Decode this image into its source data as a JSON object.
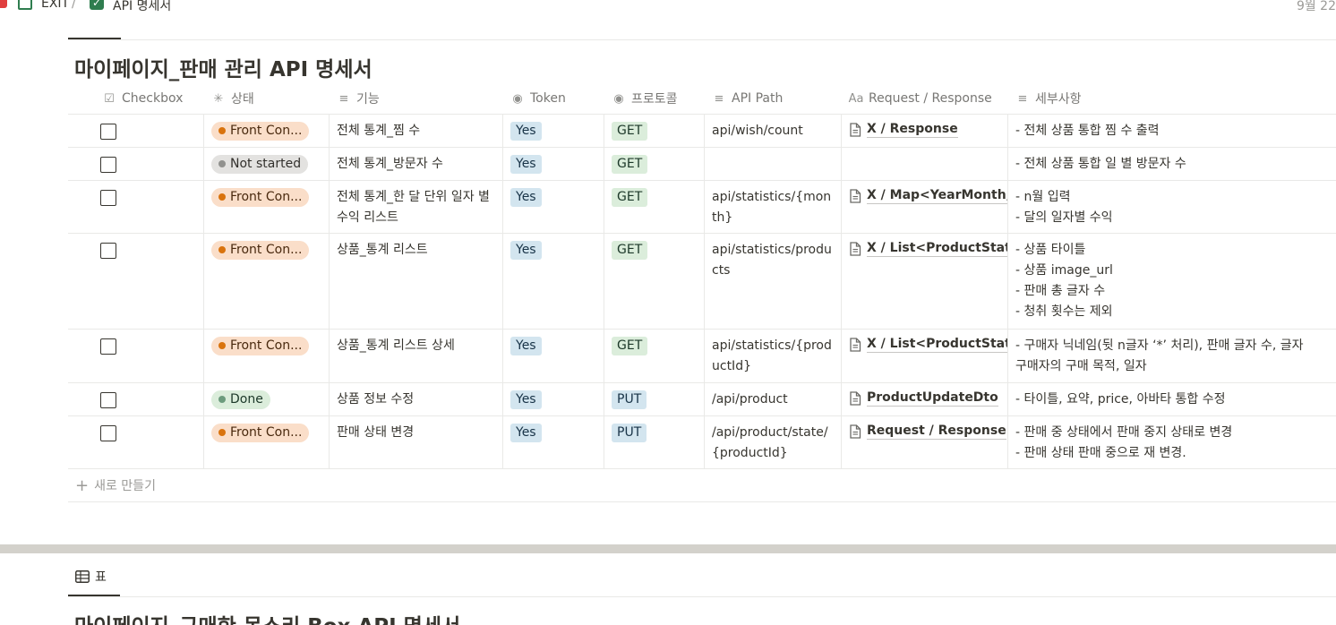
{
  "breadcrumb": {
    "items": [
      "EXIT",
      "API 명세서"
    ],
    "separator": "/",
    "date": "9월 22"
  },
  "database": {
    "view_tab": "",
    "title": "마이페이지_판매 관리 API 명세서",
    "columns": [
      {
        "label": "Checkbox",
        "icon": "checkbox-icon"
      },
      {
        "label": "상태",
        "icon": "status-spinner-icon"
      },
      {
        "label": "기능",
        "icon": "text-lines-icon"
      },
      {
        "label": "Token",
        "icon": "select-icon"
      },
      {
        "label": "프로토콜",
        "icon": "select-icon"
      },
      {
        "label": "API Path",
        "icon": "text-lines-icon"
      },
      {
        "label": "Request / Response",
        "icon": "title-aa-icon"
      },
      {
        "label": "세부사항",
        "icon": "text-lines-icon"
      }
    ],
    "rows": [
      {
        "checked": false,
        "status": "Front Con...",
        "status_kind": "front",
        "feature": "전체 통계_찜 수",
        "token": "Yes",
        "protocol": "GET",
        "api_path": "api/wish/count",
        "request_response": "X / Response",
        "details": [
          "- 전체 상품 통합 찜 수 출력"
        ]
      },
      {
        "checked": false,
        "status": "Not started",
        "status_kind": "not",
        "feature": "전체 통계_방문자 수",
        "token": "Yes",
        "protocol": "GET",
        "api_path": "",
        "request_response": "",
        "details": [
          "- 전체 상품 통합 일 별 방문자 수"
        ]
      },
      {
        "checked": false,
        "status": "Front Con...",
        "status_kind": "front",
        "feature": "전체 통계_한 달 단위 일자 별 수익 리스트",
        "token": "Yes",
        "protocol": "GET",
        "api_path": "api/statistics/{month}",
        "request_response": "X / Map<YearMonth,",
        "details": [
          "- n월 입력",
          "- 달의 일자별 수익"
        ]
      },
      {
        "checked": false,
        "status": "Front Con...",
        "status_kind": "front",
        "feature": "상품_통계 리스트",
        "token": "Yes",
        "protocol": "GET",
        "api_path": "api/statistics/products",
        "request_response": "X / List<ProductStatis",
        "details": [
          "- 상품 타이틀",
          "- 상품 image_url",
          "- 판매 총 글자 수",
          "- 청취 횟수는 제외"
        ]
      },
      {
        "checked": false,
        "status": "Front Con...",
        "status_kind": "front",
        "feature": "상품_통계 리스트 상세",
        "token": "Yes",
        "protocol": "GET",
        "api_path": "api/statistics/{productId}",
        "request_response": "X / List<ProductStatis",
        "details": [
          "- 구매자 닉네임(뒷 n글자 ‘*’ 처리), 판매 글자 수, 글자",
          "구매자의 구매 목적, 일자"
        ]
      },
      {
        "checked": false,
        "status": "Done",
        "status_kind": "done",
        "feature": "상품 정보 수정",
        "token": "Yes",
        "protocol": "PUT",
        "api_path": "/api/product",
        "request_response": "ProductUpdateDto",
        "details": [
          "- 타이틀, 요약, price, 아바타 통합 수정"
        ]
      },
      {
        "checked": false,
        "status": "Front Con...",
        "status_kind": "front",
        "feature": "판매 상태 변경",
        "token": "Yes",
        "protocol": "PUT",
        "api_path": "/api/product/state/{productId}",
        "request_response": "Request / Response",
        "details": [
          "- 판매 중 상태에서  판매 중지 상태로 변경",
          "- 판매 상태 판매 중으로 재 변경."
        ]
      }
    ],
    "new_row_label": "새로 만들기"
  },
  "database2": {
    "view_tab": "표",
    "title": "마이페이지_구매한 목소리 Box API 명세서"
  },
  "colors": {
    "front_bg": "#fadec9",
    "front_dot": "#d9730d",
    "not_bg": "#e3e2e0",
    "done_bg": "#dbeddb",
    "yes_bg": "#d3e5ef",
    "get_bg": "#dbeddb",
    "put_bg": "#d3e5ef",
    "separator": "#d3d1cb"
  }
}
